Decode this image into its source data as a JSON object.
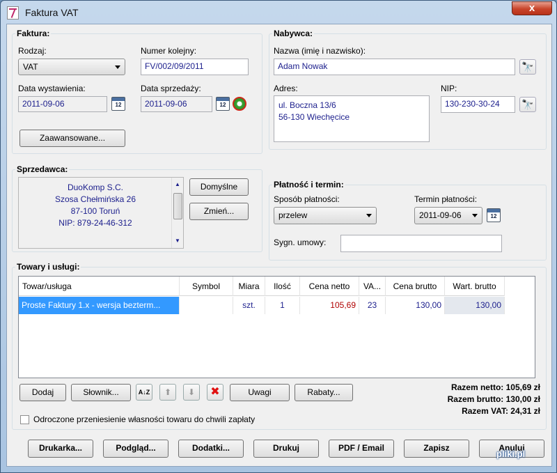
{
  "window": {
    "title": "Faktura VAT",
    "close_label": "x"
  },
  "faktura": {
    "legend": "Faktura:",
    "rodzaj_label": "Rodzaj:",
    "rodzaj_value": "VAT",
    "numer_label": "Numer kolejny:",
    "numer_value": "FV/002/09/2011",
    "data_wyst_label": "Data wystawienia:",
    "data_wyst_value": "2011-09-06",
    "data_sprz_label": "Data sprzedaży:",
    "data_sprz_value": "2011-09-06",
    "calendar_icon_text": "12",
    "advanced_button": "Zaawansowane..."
  },
  "nabywca": {
    "legend": "Nabywca:",
    "nazwa_label": "Nazwa (imię i nazwisko):",
    "nazwa_value": "Adam Nowak",
    "adres_label": "Adres:",
    "adres_line1": "ul. Boczna 13/6",
    "adres_line2": "56-130 Wiechęcice",
    "nip_label": "NIP:",
    "nip_value": "130-230-30-24",
    "search_glyph": "🔭"
  },
  "sprzedawca": {
    "legend": "Sprzedawca:",
    "lines": [
      "DuoKomp S.C.",
      "Szosa Chełmińska 26",
      "87-100 Toruń",
      "NIP: 879-24-46-312"
    ],
    "default_button": "Domyślne",
    "change_button": "Zmień..."
  },
  "platnosc": {
    "legend": "Płatność i termin:",
    "sposob_label": "Sposób płatności:",
    "sposob_value": "przelew",
    "termin_label": "Termin płatności:",
    "termin_value": "2011-09-06",
    "sygn_label": "Sygn. umowy:",
    "sygn_value": ""
  },
  "towary": {
    "legend": "Towary i usługi:",
    "columns": [
      "Towar/usługa",
      "Symbol",
      "Miara",
      "Ilość",
      "Cena netto",
      "VA...",
      "Cena brutto",
      "Wart. brutto"
    ],
    "rows": [
      {
        "towar": "Proste Faktury 1.x - wersja bezterm...",
        "symbol": "",
        "miara": "szt.",
        "ilosc": "1",
        "cena_netto": "105,69",
        "vat": "23",
        "cena_brutto": "130,00",
        "wart_brutto": "130,00"
      }
    ],
    "buttons": {
      "dodaj": "Dodaj",
      "slownik": "Słownik...",
      "uwagi": "Uwagi",
      "rabaty": "Rabaty..."
    },
    "sort_glyph": "A↓Z",
    "up_glyph": "⬆",
    "down_glyph": "⬇",
    "delete_glyph": "✖",
    "sum_netto": "Razem netto: 105,69 zł",
    "sum_brutto": "Razem brutto: 130,00 zł",
    "sum_vat": "Razem VAT: 24,31 zł",
    "checkbox_label": "Odroczone przeniesienie własności towaru do chwili zapłaty"
  },
  "bottom_buttons": [
    "Drukarka...",
    "Podgląd...",
    "Dodatki...",
    "Drukuj",
    "PDF / Email",
    "Zapisz",
    "Anuluj"
  ],
  "watermark": "pliki.pl",
  "colors": {
    "selection": "#3399ff",
    "value_text": "#1b1e8c",
    "red_value": "#b00000"
  }
}
